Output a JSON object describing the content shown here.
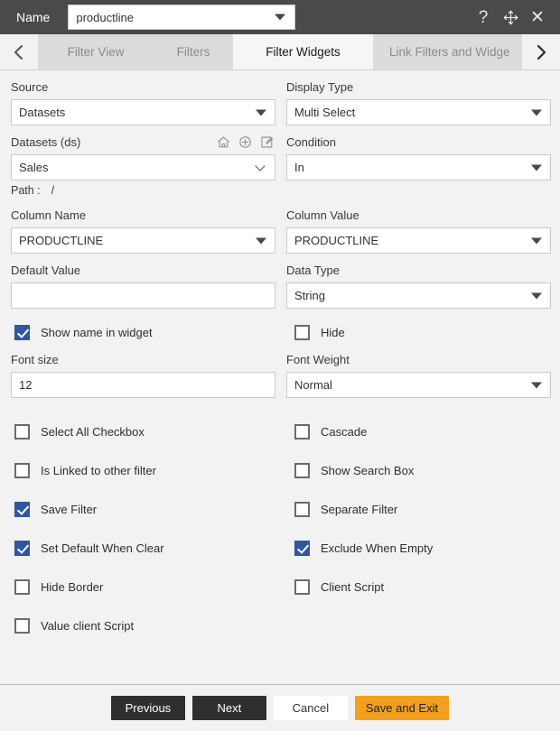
{
  "titlebar": {
    "name_label": "Name",
    "name_value": "productline",
    "help_icon": "question-mark-icon",
    "move_icon": "move-arrows-icon",
    "close_icon": "close-icon"
  },
  "tabs": {
    "prev_arrow": "chevron-left-icon",
    "next_arrow": "chevron-right-icon",
    "items": [
      {
        "label": "Filter View",
        "active": false
      },
      {
        "label": "Filters",
        "active": false
      },
      {
        "label": "Filter Widgets",
        "active": true
      },
      {
        "label": "Link Filters and Widge",
        "active": false
      }
    ]
  },
  "form": {
    "source": {
      "label": "Source",
      "value": "Datasets"
    },
    "display_type": {
      "label": "Display Type",
      "value": "Multi Select"
    },
    "datasets": {
      "label": "Datasets (ds)",
      "value": "Sales",
      "icons": [
        "home-icon",
        "plus-circle-icon",
        "edit-pencil-icon"
      ],
      "path_label": "Path :",
      "path_value": "/"
    },
    "condition": {
      "label": "Condition",
      "value": "In"
    },
    "column_name": {
      "label": "Column Name",
      "value": "PRODUCTLINE"
    },
    "column_value": {
      "label": "Column Value",
      "value": "PRODUCTLINE"
    },
    "default_value": {
      "label": "Default Value",
      "value": ""
    },
    "data_type": {
      "label": "Data Type",
      "value": "String"
    },
    "show_name_in_widget": {
      "label": "Show name in widget",
      "checked": true
    },
    "hide": {
      "label": "Hide",
      "checked": false
    },
    "font_size": {
      "label": "Font size",
      "value": "12"
    },
    "font_weight": {
      "label": "Font Weight",
      "value": "Normal"
    },
    "options": [
      {
        "label": "Select All Checkbox",
        "checked": false
      },
      {
        "label": "Cascade",
        "checked": false
      },
      {
        "label": "Is Linked to other filter",
        "checked": false
      },
      {
        "label": "Show Search Box",
        "checked": false
      },
      {
        "label": "Save Filter",
        "checked": true
      },
      {
        "label": "Separate Filter",
        "checked": false
      },
      {
        "label": "Set Default When Clear",
        "checked": true
      },
      {
        "label": "Exclude When Empty",
        "checked": true
      },
      {
        "label": "Hide Border",
        "checked": false
      },
      {
        "label": "Client Script",
        "checked": false
      },
      {
        "label": "Value client Script",
        "checked": false
      }
    ]
  },
  "footer": {
    "previous": "Previous",
    "next": "Next",
    "cancel": "Cancel",
    "save_and_exit": "Save and Exit"
  },
  "colors": {
    "titlebar_bg": "#4a4a4a",
    "tab_bg": "#dcdcdc",
    "tab_active_bg": "#f6f6f6",
    "page_bg": "#f2f2f2",
    "checkbox_checked": "#31569f",
    "accent_button": "#f2a01e",
    "dark_button": "#2f2f2f"
  }
}
